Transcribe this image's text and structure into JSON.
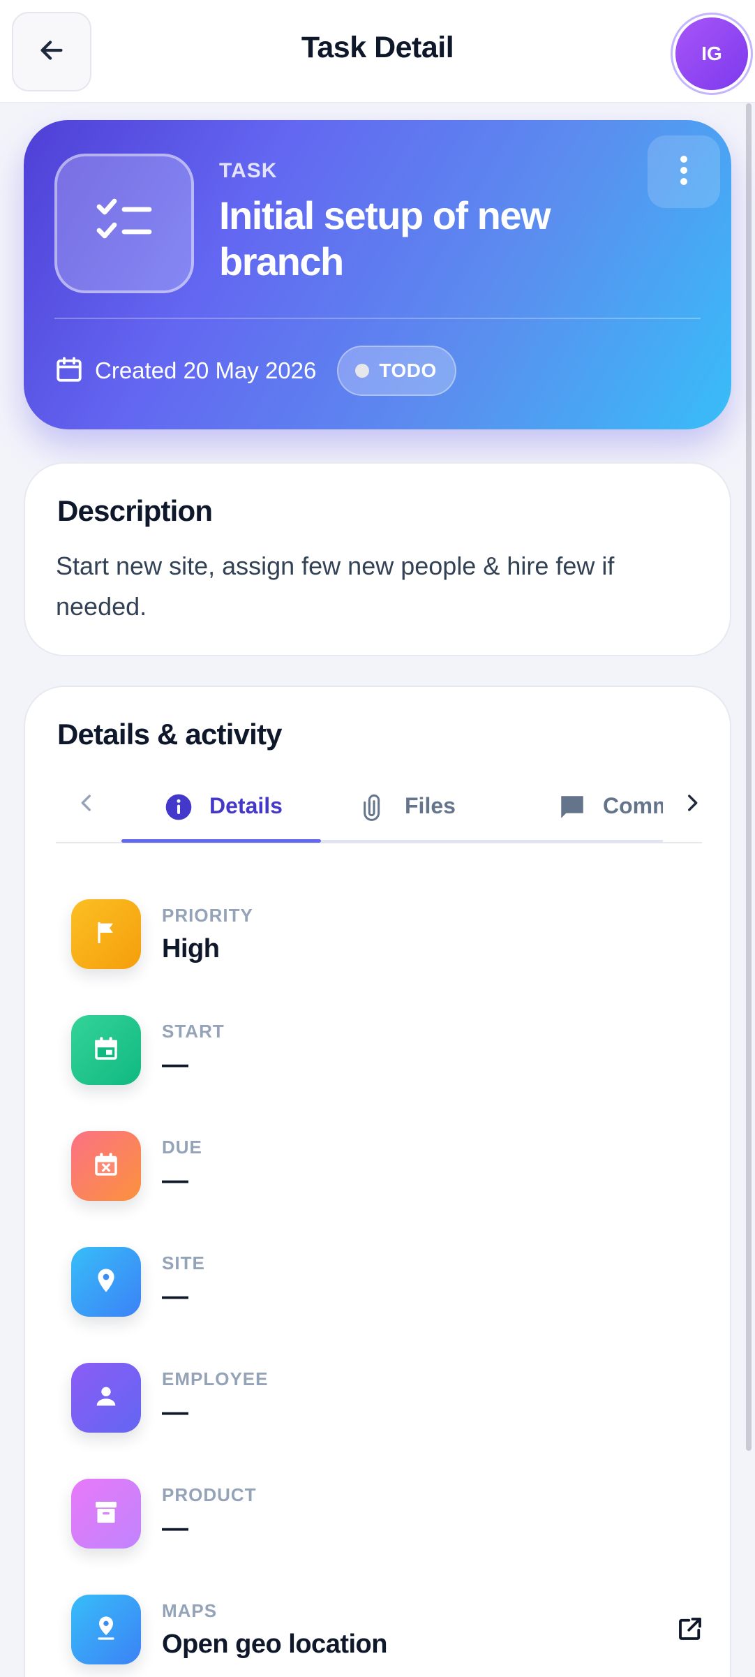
{
  "header": {
    "title": "Task Detail",
    "avatar_initials": "IG"
  },
  "hero": {
    "eyebrow": "TASK",
    "title": "Initial setup of new branch",
    "created": "Created 20 May 2026",
    "status": "TODO"
  },
  "description": {
    "heading": "Description",
    "text": "Start new site, assign few new people & hire few if needed."
  },
  "details": {
    "heading": "Details & activity",
    "tabs": [
      {
        "label": "Details",
        "icon": "info-icon",
        "active": true
      },
      {
        "label": "Files",
        "icon": "paperclip-icon",
        "active": false
      },
      {
        "label": "Comments",
        "icon": "comment-icon",
        "active": false
      }
    ],
    "rows": [
      {
        "label": "PRIORITY",
        "value": "High",
        "icon": "flag-icon",
        "color": "#fbbf24"
      },
      {
        "label": "START",
        "value": "—",
        "icon": "calendar-icon",
        "color": "#10b981"
      },
      {
        "label": "DUE",
        "value": "—",
        "icon": "calendar-x-icon",
        "color": "#fb7185"
      },
      {
        "label": "SITE",
        "value": "—",
        "icon": "location-pin-icon",
        "color": "#3b82f6"
      },
      {
        "label": "EMPLOYEE",
        "value": "—",
        "icon": "person-icon",
        "color": "#8b5cf6"
      },
      {
        "label": "PRODUCT",
        "value": "—",
        "icon": "archive-box-icon",
        "color": "#d946ef"
      },
      {
        "label": "MAPS",
        "value": "Open geo location",
        "icon": "map-pin-icon",
        "color": "#3b82f6",
        "action_icon": "external-link-icon"
      }
    ]
  },
  "colors": {
    "accent": "#6366f1",
    "accent_dark": "#4338ca",
    "background": "#f3f4fa"
  }
}
